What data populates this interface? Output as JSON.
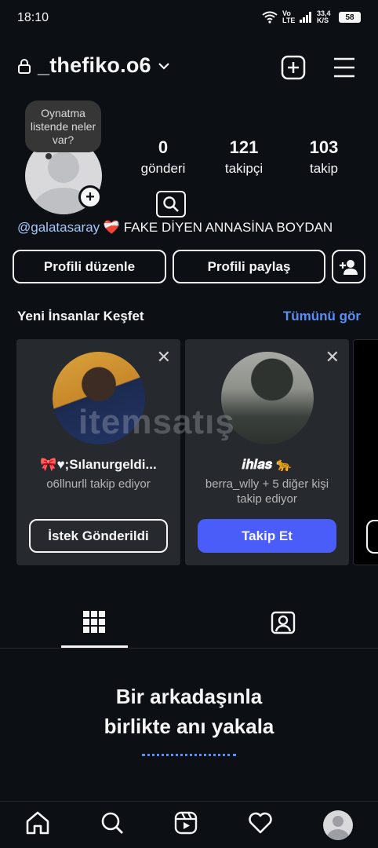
{
  "status_bar": {
    "time": "18:10",
    "network": "Vo LTE",
    "speed": "33,4 K/S",
    "battery": "58"
  },
  "header": {
    "username": "_thefiko.o6"
  },
  "profile": {
    "note": "Oynatma listende neler var?",
    "stats": [
      {
        "value": "0",
        "label": "gönderi"
      },
      {
        "value": "121",
        "label": "takipçi"
      },
      {
        "value": "103",
        "label": "takip"
      }
    ],
    "bio_mention": "@galatasaray",
    "bio_heart": "❤️‍🩹",
    "bio_text": "FAKE DİYEN ANNASİNA BOYDAN"
  },
  "actions": {
    "edit": "Profili düzenle",
    "share": "Profili paylaş"
  },
  "discover": {
    "title": "Yeni İnsanlar Keşfet",
    "see_all": "Tümünü gör",
    "cards": [
      {
        "name": "🎀♥;Sılanurgeldi...",
        "sub": "o6llnurll takip ediyor",
        "button": "İstek Gönderildi"
      },
      {
        "name": "𝒊𝒉𝒍𝒂𝒔 🐆",
        "sub": "berra_wlly + 5 diğer kişi takip ediyor",
        "button": "Takip Et"
      }
    ]
  },
  "watermark": "itemsatış",
  "empty_state": {
    "line1": "Bir arkadaşınla",
    "line2": "birlikte anı yakala"
  },
  "colors": {
    "background": "#0c1014",
    "card": "#262a2f",
    "accent": "#4a5df9",
    "link": "#5b8ef7"
  },
  "icons": [
    "lock-icon",
    "chevron-down-icon",
    "create-icon",
    "menu-icon",
    "search-icon",
    "add-person-icon",
    "grid-icon",
    "tagged-icon",
    "home-icon",
    "reels-icon",
    "heart-icon"
  ]
}
